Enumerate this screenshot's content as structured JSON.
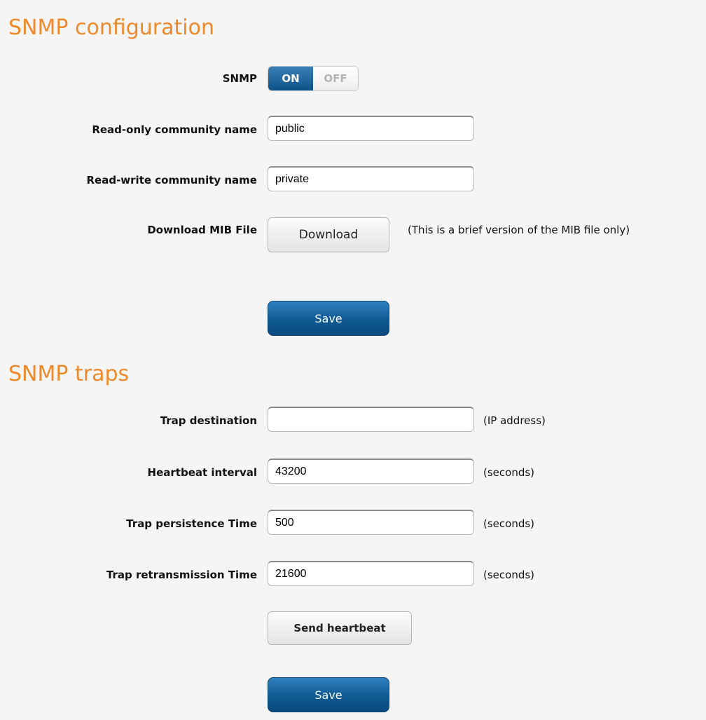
{
  "snmp_config": {
    "title": "SNMP configuration",
    "snmp_label": "SNMP",
    "toggle": {
      "on_label": "ON",
      "off_label": "OFF",
      "selected": "ON"
    },
    "read_only": {
      "label": "Read-only community name",
      "value": "public"
    },
    "read_write": {
      "label": "Read-write community name",
      "value": "private"
    },
    "mib": {
      "label": "Download MIB File",
      "button_label": "Download",
      "note": "(This is a brief version of the MIB file only)"
    },
    "save_label": "Save"
  },
  "snmp_traps": {
    "title": "SNMP traps",
    "trap_destination": {
      "label": "Trap destination",
      "value": "",
      "suffix": "(IP address)"
    },
    "heartbeat_interval": {
      "label": "Heartbeat interval",
      "value": "43200",
      "suffix": "(seconds)"
    },
    "trap_persistence": {
      "label": "Trap persistence Time",
      "value": "500",
      "suffix": "(seconds)"
    },
    "trap_retransmission": {
      "label": "Trap retransmission Time",
      "value": "21600",
      "suffix": "(seconds)"
    },
    "send_heartbeat_label": "Send heartbeat",
    "save_label": "Save"
  },
  "colors": {
    "accent_title": "#ee8a2c",
    "primary_button": "#0f5a93",
    "toggle_on": "#0d5388"
  }
}
